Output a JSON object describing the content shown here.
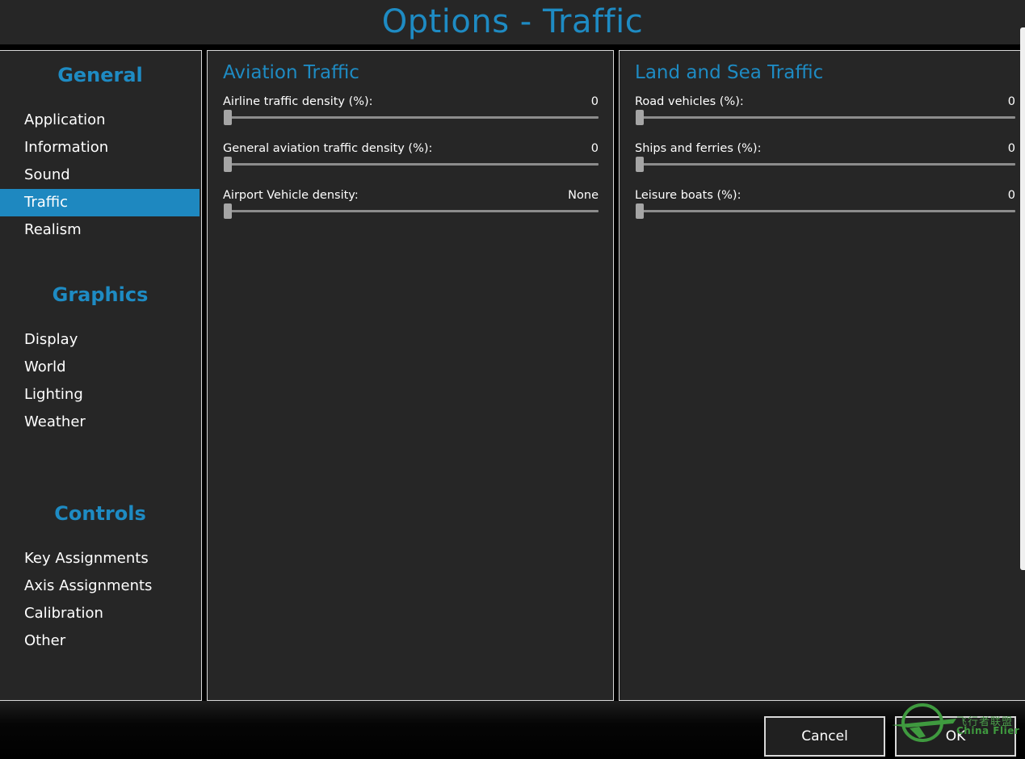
{
  "window": {
    "title": "Options - Traffic"
  },
  "sidebar": {
    "sections": [
      {
        "heading": "General",
        "items": [
          "Application",
          "Information",
          "Sound",
          "Traffic",
          "Realism"
        ]
      },
      {
        "heading": "Graphics",
        "items": [
          "Display",
          "World",
          "Lighting",
          "Weather"
        ]
      },
      {
        "heading": "Controls",
        "items": [
          "Key Assignments",
          "Axis Assignments",
          "Calibration",
          "Other"
        ]
      }
    ],
    "active_item": "Traffic"
  },
  "aviation": {
    "heading": "Aviation Traffic",
    "settings": [
      {
        "label": "Airline traffic density (%):",
        "value": "0",
        "level": 0
      },
      {
        "label": "General aviation traffic density (%):",
        "value": "0",
        "level": 0
      },
      {
        "label": "Airport Vehicle density:",
        "value": "None",
        "level": 0
      }
    ]
  },
  "landsea": {
    "heading": "Land and Sea Traffic",
    "settings": [
      {
        "label": "Road vehicles (%):",
        "value": "0",
        "level": 0
      },
      {
        "label": "Ships and ferries (%):",
        "value": "0",
        "level": 0
      },
      {
        "label": "Leisure boats (%):",
        "value": "0",
        "level": 0
      }
    ]
  },
  "footer": {
    "cancel_label": "Cancel",
    "ok_label": "OK"
  },
  "watermark": {
    "cn_text": "飞行者联盟",
    "en_text": "China Flier"
  },
  "colors": {
    "accent": "#1e8bc3",
    "active_item_bg": "#1e88c0",
    "panel_bg": "#262626",
    "watermark_green": "#3f9a3f"
  }
}
